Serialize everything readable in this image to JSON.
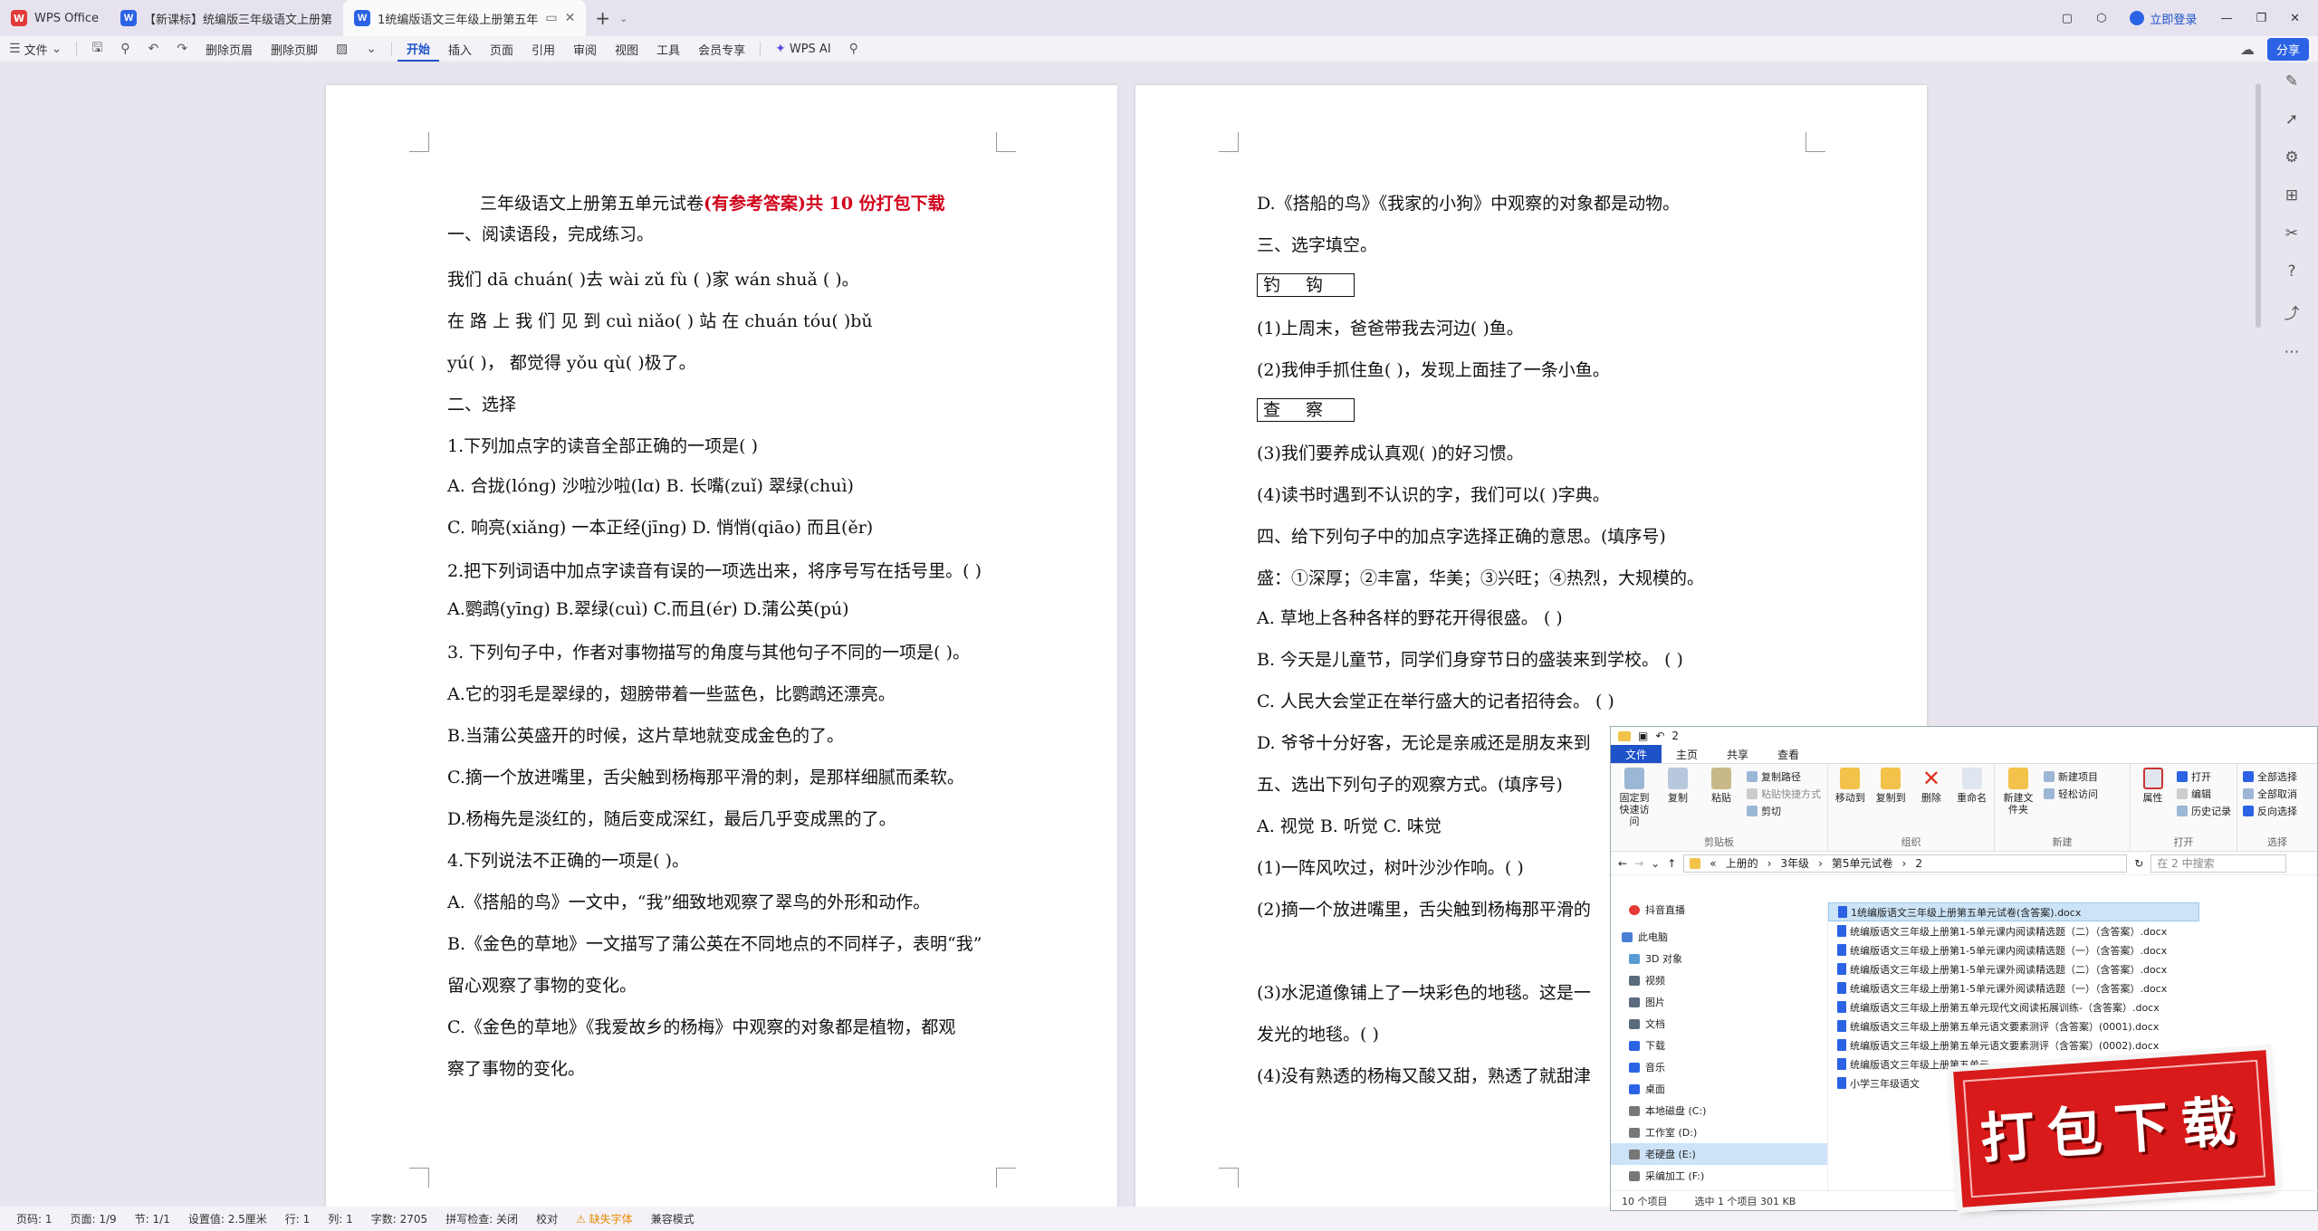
{
  "tabs": [
    {
      "label": "WPS Office",
      "icon": "wps-logo-icon"
    },
    {
      "label": "【新课标】统编版三年级语文上册第",
      "icon": "word-doc-icon"
    },
    {
      "label": "1统编版语文三年级上册第五年",
      "icon": "word-doc-icon"
    }
  ],
  "topbar": {
    "login": "立即登录"
  },
  "toolbar": {
    "file": "文件",
    "delete_header": "删除页眉",
    "delete_footer": "删除页脚",
    "menu": [
      "开始",
      "插入",
      "页面",
      "引用",
      "审阅",
      "视图",
      "工具",
      "会员专享"
    ],
    "wps_ai": "WPS AI",
    "share": "分享"
  },
  "page1": {
    "title_black": "三年级语文上册第五单元试卷",
    "title_red": "(有参考答案)共 10 份打包下载",
    "lines": [
      "一、阅读语段，完成练习。",
      "我们 dā  chuán(          )去 wài zǔ fù (           )家 wán shuǎ (          )。",
      "在 路 上 我 们 见 到  cuì  niǎo(          )  站 在  chuán  tóu(          )bǔ",
      "yú(           )， 都觉得 yǒu  qù(          )极了。",
      "二、选择",
      "1.下列加点字的读音全部正确的一项是(       )",
      "A.  合拢(lónɡ)     沙啦沙啦(lɑ)        B.  长嘴(zuǐ)     翠绿(chuì)",
      "C.  响亮(xiǎnɡ)    一本正经(jīnɡ)   D.  悄悄(qiāo)     而且(ěr)",
      "2.把下列词语中加点字读音有误的一项选出来，将序号写在括号里。( )",
      "A.鹦鹉(yīnɡ)    B.翠绿(cuì)       C.而且(ér)       D.蒲公英(pú)",
      "3. 下列句子中，作者对事物描写的角度与其他句子不同的一项是(       )。",
      "A.它的羽毛是翠绿的，翅膀带着一些蓝色，比鹦鹉还漂亮。",
      "B.当蒲公英盛开的时候，这片草地就变成金色的了。",
      "C.摘一个放进嘴里，舌尖触到杨梅那平滑的刺，是那样细腻而柔软。",
      "D.杨梅先是淡红的，随后变成深红，最后几乎变成黑的了。",
      "4.下列说法不正确的一项是(       )。",
      "A.《搭船的鸟》一文中，“我”细致地观察了翠鸟的外形和动作。",
      "B.《金色的草地》一文描写了蒲公英在不同地点的不同样子，表明“我”",
      "留心观察了事物的变化。",
      "C.《金色的草地》《我爱故乡的杨梅》中观察的对象都是植物，都观",
      "察了事物的变化。"
    ]
  },
  "page2": {
    "lines": [
      "D.《搭船的鸟》《我家的小狗》中观察的对象都是动物。",
      "三、选字填空。",
      "钓钩",
      "(1)上周末，爸爸带我去河边(            )鱼。",
      "(2)我伸手抓住鱼(            )，发现上面挂了一条小鱼。",
      "查察",
      "(3)我们要养成认真观(            )的好习惯。",
      "(4)读书时遇到不认识的字，我们可以(            )字典。",
      "四、给下列句子中的加点字选择正确的意思。(填序号)",
      "盛：①深厚；②丰富，华美；③兴旺；④热烈，大规模的。",
      "A.  草地上各种各样的野花开得很盛。                                 (       )",
      "B.  今天是儿童节，同学们身穿节日的盛装来到学校。          (       )",
      "C.  人民大会堂正在举行盛大的记者招待会。                      (       )",
      "D.  爷爷十分好客，无论是亲戚还是朋友来到",
      "五、选出下列句子的观察方式。(填序号)",
      "A.  视觉          B.  听觉          C.  味觉",
      "(1)一阵风吹过，树叶沙沙作响。(        )",
      "(2)摘一个放进嘴里，舌尖触到杨梅那平滑的",
      "(3)水泥道像铺上了一块彩色的地毯。这是一",
      "发光的地毯。(        )",
      "(4)没有熟透的杨梅又酸又甜，熟透了就甜津"
    ]
  },
  "status": {
    "page": "页码: 1",
    "pages": "页面: 1/9",
    "section": "节: 1/1",
    "setting": "设置值: 2.5厘米",
    "row": "行: 1",
    "col": "列: 1",
    "words": "字数: 2705",
    "spell": "拼写检查: 关闭",
    "proof": "校对",
    "font_missing": "缺失字体",
    "compat": "兼容模式"
  },
  "explorer": {
    "title": "2",
    "tabs": [
      "文件",
      "主页",
      "共享",
      "查看"
    ],
    "ribbon": {
      "pin": "固定到快速访问",
      "copy": "复制",
      "paste": "粘贴",
      "copy_path": "复制路径",
      "paste_shortcut": "粘贴快捷方式",
      "cut": "剪切",
      "clipboard": "剪贴板",
      "move_to": "移动到",
      "copy_to": "复制到",
      "delete": "删除",
      "rename": "重命名",
      "organize": "组织",
      "new_item": "新建项目",
      "easy_access": "轻松访问",
      "new_folder": "新建文件夹",
      "new": "新建",
      "properties": "属性",
      "open": "打开",
      "edit": "编辑",
      "history": "历史记录",
      "open_group": "打开",
      "select_all": "全部选择",
      "select_none": "全部取消",
      "invert": "反向选择",
      "select": "选择"
    },
    "path": [
      "«",
      "上册的",
      "3年级",
      "第5单元试卷",
      "2"
    ],
    "search_placeholder": "在 2 中搜索",
    "nav": [
      {
        "label": "抖音直播",
        "color": "#e53935"
      },
      {
        "label": "此电脑",
        "color": "#4a7fd6"
      },
      {
        "label": "3D 对象",
        "color": "#5b9bd5"
      },
      {
        "label": "视频",
        "color": "#5b6b7d"
      },
      {
        "label": "图片",
        "color": "#5b6b7d"
      },
      {
        "label": "文档",
        "color": "#5b6b7d"
      },
      {
        "label": "下载",
        "color": "#2b63e4"
      },
      {
        "label": "音乐",
        "color": "#2b63e4"
      },
      {
        "label": "桌面",
        "color": "#2b63e4"
      },
      {
        "label": "本地磁盘 (C:)",
        "color": "#777"
      },
      {
        "label": "工作室 (D:)",
        "color": "#777"
      },
      {
        "label": "老硬盘 (E:)",
        "color": "#777"
      },
      {
        "label": "采编加工 (F:)",
        "color": "#777"
      }
    ],
    "files": [
      "1统编版语文三年级上册第五单元试卷(含答案).docx",
      "统编版语文三年级上册第1-5单元课内阅读精选题（二）（含答案）.docx",
      "统编版语文三年级上册第1-5单元课内阅读精选题（一）（含答案）.docx",
      "统编版语文三年级上册第1-5单元课外阅读精选题（二）（含答案）.docx",
      "统编版语文三年级上册第1-5单元课外阅读精选题（一）（含答案）.docx",
      "统编版语文三年级上册第五单元现代文阅读拓展训练-（含答案）.docx",
      "统编版语文三年级上册第五单元语文要素测评（含答案）(0001).docx",
      "统编版语文三年级上册第五单元语文要素测评（含答案）(0002).docx",
      "统编版语文三年级上册第五单元",
      "小学三年级语文"
    ],
    "status_count": "10 个项目",
    "status_selected": "选中 1 个项目  301 KB"
  },
  "promo": {
    "text": "打包下载"
  }
}
